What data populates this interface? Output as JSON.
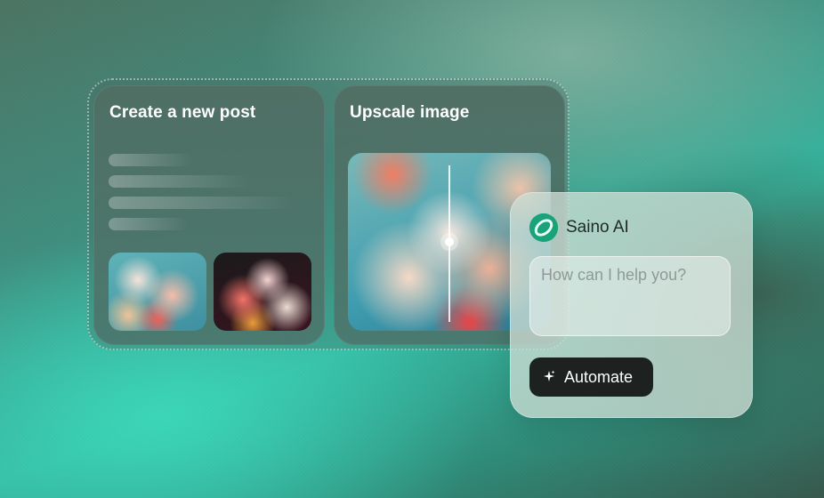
{
  "cards": {
    "post": {
      "title": "Create a new post"
    },
    "upscale": {
      "title": "Upscale image"
    }
  },
  "assistant": {
    "name": "Saino AI",
    "logo_icon": "saino-logo-icon",
    "input_placeholder": "How can I help you?",
    "button_label": "Automate",
    "button_icon": "sparkle-icon"
  },
  "colors": {
    "accent": "#1aa37a",
    "button_bg": "#1d2120"
  }
}
